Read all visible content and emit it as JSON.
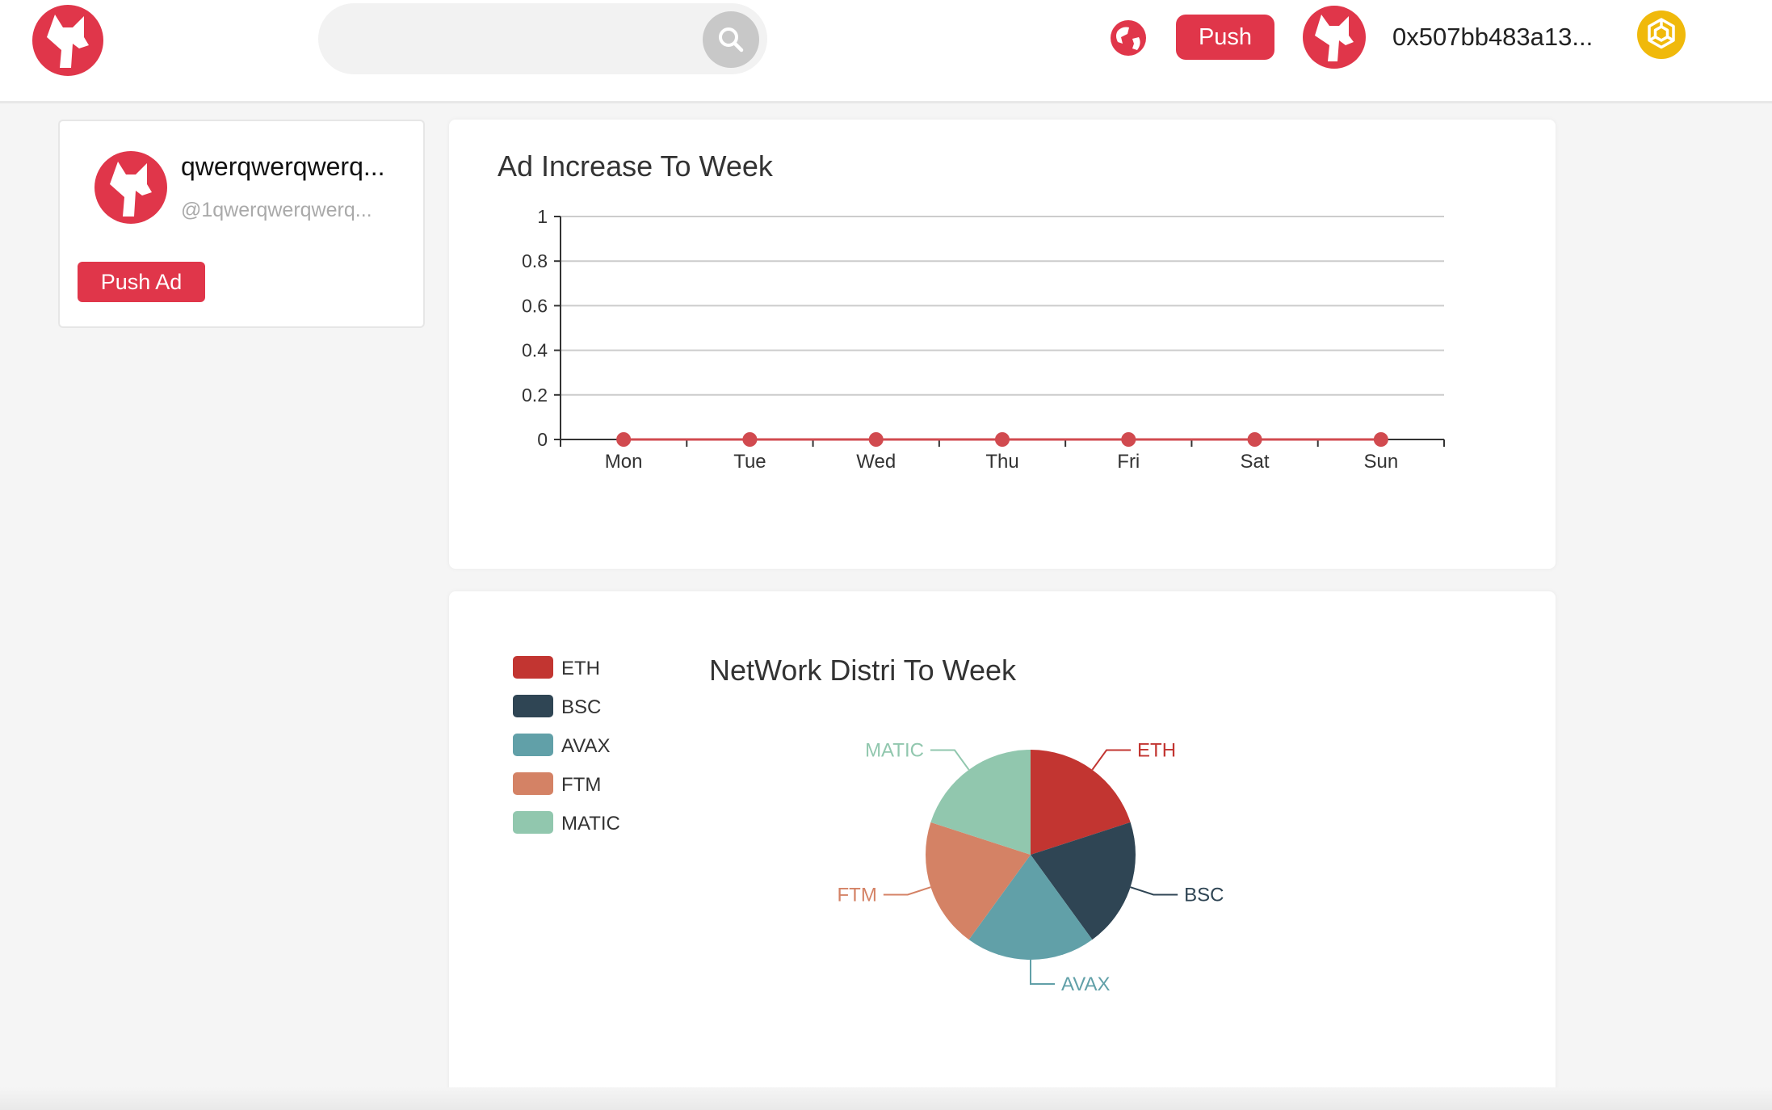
{
  "header": {
    "search": {
      "placeholder": "",
      "value": ""
    },
    "push_label": "Push",
    "wallet_address": "0x507bb483a13..."
  },
  "profile": {
    "name": "qwerqwerqwerq...",
    "handle": "@1qwerqwerqwerq...",
    "push_ad_label": "Push Ad"
  },
  "colors": {
    "accent": "#e0364a",
    "bnb": "#f0b90b"
  },
  "chart_data": [
    {
      "type": "line",
      "title": "Ad Increase To Week",
      "categories": [
        "Mon",
        "Tue",
        "Wed",
        "Thu",
        "Fri",
        "Sat",
        "Sun"
      ],
      "series": [
        {
          "values": [
            0,
            0,
            0,
            0,
            0,
            0,
            0
          ]
        }
      ],
      "yticks": [
        "0",
        "0.2",
        "0.4",
        "0.6",
        "0.8",
        "1"
      ],
      "ylim": [
        0,
        1
      ],
      "grid": true,
      "point_color": "#d14a4f"
    },
    {
      "type": "pie",
      "title": "NetWork Distri To Week",
      "legend_position": "top-left",
      "slices": [
        {
          "label": "ETH",
          "value": 1,
          "color": "#c23531"
        },
        {
          "label": "BSC",
          "value": 1,
          "color": "#2f4554"
        },
        {
          "label": "AVAX",
          "value": 1,
          "color": "#61a0a8"
        },
        {
          "label": "FTM",
          "value": 1,
          "color": "#d48265"
        },
        {
          "label": "MATIC",
          "value": 1,
          "color": "#91c7ae"
        }
      ]
    }
  ]
}
